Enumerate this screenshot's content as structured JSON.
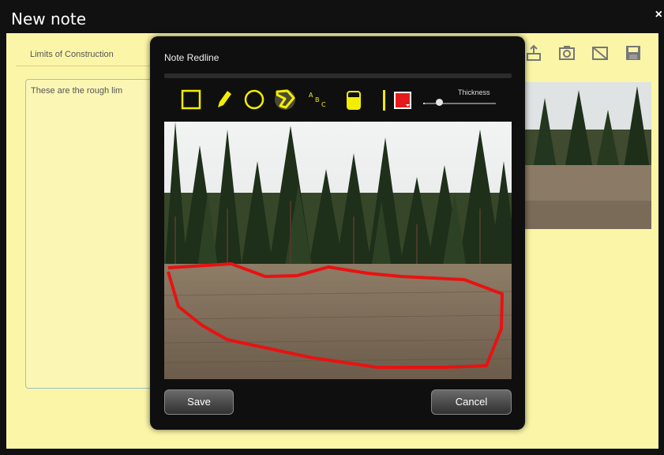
{
  "window": {
    "title": "New note",
    "close": "×"
  },
  "note": {
    "subject": "Limits of Construction",
    "body_preview": "These are the rough lim",
    "icons": [
      "share-icon",
      "camera-icon",
      "no-image-icon",
      "save-disk-icon"
    ]
  },
  "dialog": {
    "title": "Note Redline",
    "tools": [
      "rectangle-icon",
      "pencil-icon",
      "circle-icon",
      "polygon-icon",
      "text-icon",
      "highlighter-icon",
      "color-picker-icon"
    ],
    "thickness_label": "Thickness",
    "thickness_value": 0.2,
    "selected_tool": "polygon-icon",
    "colors": {
      "tool": "#f3ee00",
      "selected_glow": "#fff7a0",
      "redline": "#e81212",
      "swatch": "#e51b1b"
    },
    "save_label": "Save",
    "cancel_label": "Cancel"
  }
}
